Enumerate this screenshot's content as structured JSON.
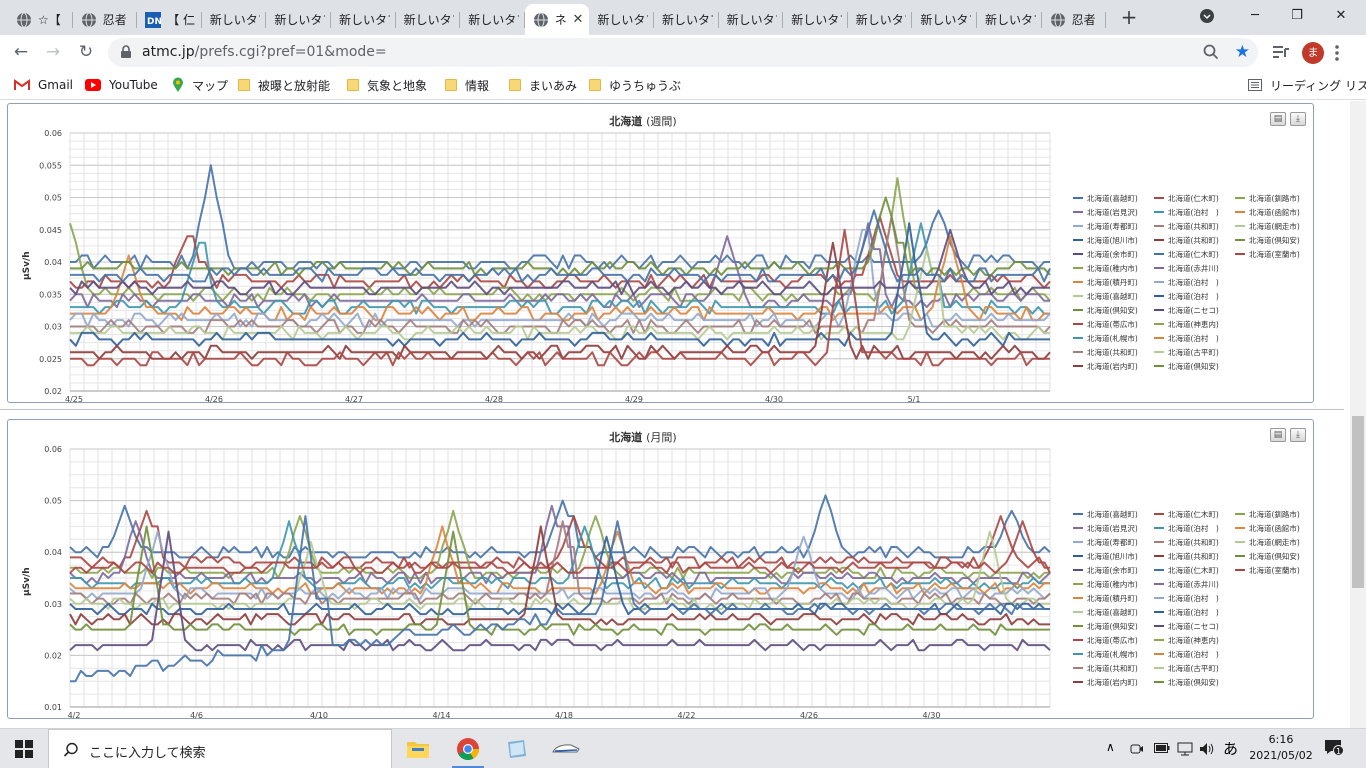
{
  "browser": {
    "tabs": [
      {
        "title": "☆【",
        "icon": "globe-icon",
        "active": false
      },
      {
        "title": "忍者",
        "icon": "globe-icon",
        "active": false
      },
      {
        "title": "【 仁",
        "icon": "dn-logo-icon",
        "active": false
      },
      {
        "title": "新しいタブ",
        "icon": "",
        "active": false
      },
      {
        "title": "新しいタブ",
        "icon": "",
        "active": false
      },
      {
        "title": "新しいタブ",
        "icon": "",
        "active": false
      },
      {
        "title": "新しいタブ",
        "icon": "",
        "active": false
      },
      {
        "title": "新しいタブ",
        "icon": "",
        "active": false
      },
      {
        "title": "ネ",
        "icon": "globe-icon",
        "active": true
      },
      {
        "title": "新しいタブ",
        "icon": "",
        "active": false
      },
      {
        "title": "新しいタブ",
        "icon": "",
        "active": false
      },
      {
        "title": "新しいタブ",
        "icon": "",
        "active": false
      },
      {
        "title": "新しいタブ",
        "icon": "",
        "active": false
      },
      {
        "title": "新しいタブ",
        "icon": "",
        "active": false
      },
      {
        "title": "新しいタブ",
        "icon": "",
        "active": false
      },
      {
        "title": "新しいタブ",
        "icon": "",
        "active": false
      },
      {
        "title": "忍者",
        "icon": "globe-icon",
        "active": false
      }
    ],
    "url_host": "atmc.jp",
    "url_path": "/prefs.cgi?pref=01&mode=",
    "profile_initial": "ま",
    "bookmarks": [
      {
        "label": "Gmail",
        "icon": "gmail-icon"
      },
      {
        "label": "YouTube",
        "icon": "youtube-icon"
      },
      {
        "label": "マップ",
        "icon": "maps-pin-icon"
      },
      {
        "label": "被曝と放射能",
        "icon": "folder-icon"
      },
      {
        "label": "気象と地象",
        "icon": "folder-icon"
      },
      {
        "label": "情報",
        "icon": "folder-icon"
      },
      {
        "label": "まいあみ",
        "icon": "folder-icon"
      },
      {
        "label": "ゆうちゅうぶ",
        "icon": "folder-icon"
      }
    ],
    "reading_list": "リーディング リスト"
  },
  "colors": {
    "accent": "#1a73e8",
    "series_palette": [
      "#4572a7",
      "#aa4643",
      "#89a54e",
      "#80699b",
      "#3d96ae",
      "#db843d",
      "#92a8cd",
      "#a47d7c",
      "#b5ca92",
      "#2f5f98",
      "#8e3b3b",
      "#6f8f3a",
      "#5e4b7e"
    ]
  },
  "chart_data": [
    {
      "type": "line",
      "title": "北海道",
      "period": "(週間)",
      "ylabel": "μSv/h",
      "ylim": [
        0.02,
        0.06
      ],
      "yticks": [
        "0.02",
        "0.025",
        "0.03",
        "0.035",
        "0.04",
        "0.045",
        "0.05",
        "0.055",
        "0.06"
      ],
      "x_ticks": [
        "4/25",
        "4/26",
        "4/27",
        "4/28",
        "4/29",
        "4/30",
        "5/1"
      ],
      "x_points": 168,
      "legend_columns": [
        [
          "北海道(喜越町)",
          "北海道(岩見沢)",
          "北海道(寿都町)",
          "北海道(旭川市)",
          "北海道(余市町)",
          "北海道(稚内市)",
          "北海道(積丹町)",
          "北海道(喜越町)",
          "北海道(倶知安)",
          "北海道(帯広市)",
          "北海道(札幌市)",
          "北海道(共和町)",
          "北海道(岩内町)"
        ],
        [
          "北海道(仁木町)",
          "北海道(泊村　)",
          "北海道(共和町)",
          "北海道(共和町)",
          "北海道(仁木町)",
          "北海道(赤井川)",
          "北海道(泊村　)",
          "北海道(泊村　)",
          "北海道(ニセコ)",
          "北海道(神恵内)",
          "北海道(泊村　)",
          "北海道(古平町)",
          "北海道(倶知安)"
        ],
        [
          "北海道(釧路市)",
          "北海道(函館市)",
          "北海道(網走市)",
          "北海道(倶知安)",
          "北海道(室蘭市)"
        ]
      ],
      "series": [
        {
          "base": 0.04,
          "spikes": [
            [
              24,
              0.055
            ],
            [
              148,
              0.048
            ]
          ]
        },
        {
          "base": 0.037,
          "spikes": [
            [
              20,
              0.044
            ],
            [
              138,
              0.047
            ]
          ]
        },
        {
          "base": 0.035,
          "spikes": [
            [
              0,
              0.046
            ],
            [
              141,
              0.053
            ]
          ]
        },
        {
          "base": 0.034,
          "spikes": [
            [
              112,
              0.044
            ],
            [
              136,
              0.046
            ]
          ]
        },
        {
          "base": 0.033,
          "spikes": [
            [
              22,
              0.043
            ],
            [
              145,
              0.046
            ]
          ]
        },
        {
          "base": 0.032,
          "spikes": [
            [
              10,
              0.041
            ],
            [
              150,
              0.044
            ]
          ]
        },
        {
          "base": 0.031,
          "spikes": [
            [
              135,
              0.045
            ]
          ]
        },
        {
          "base": 0.03,
          "spikes": [
            [
              140,
              0.047
            ]
          ]
        },
        {
          "base": 0.029,
          "spikes": [
            [
              146,
              0.042
            ]
          ]
        },
        {
          "base": 0.028,
          "spikes": [
            [
              143,
              0.046
            ]
          ]
        },
        {
          "base": 0.026,
          "spikes": [
            [
              130,
              0.043
            ]
          ]
        },
        {
          "base": 0.039,
          "spikes": [
            [
              139,
              0.05
            ]
          ]
        },
        {
          "base": 0.036,
          "spikes": [
            [
              150,
              0.045
            ]
          ]
        },
        {
          "base": 0.038,
          "spikes": [
            [
              137,
              0.048
            ]
          ]
        },
        {
          "base": 0.025,
          "spikes": [
            [
              132,
              0.045
            ]
          ]
        }
      ]
    },
    {
      "type": "line",
      "title": "北海道",
      "period": "(月間)",
      "ylabel": "μSv/h",
      "ylim": [
        0.01,
        0.06
      ],
      "yticks": [
        "0.01",
        "0.02",
        "0.03",
        "0.04",
        "0.05",
        "0.06"
      ],
      "x_ticks": [
        "4/2",
        "4/6",
        "4/10",
        "4/14",
        "4/18",
        "4/22",
        "4/26",
        "4/30"
      ],
      "x_points": 180,
      "legend_columns": [
        [
          "北海道(喜越町)",
          "北海道(岩見沢)",
          "北海道(寿都町)",
          "北海道(旭川市)",
          "北海道(余市町)",
          "北海道(稚内市)",
          "北海道(積丹町)",
          "北海道(喜越町)",
          "北海道(倶知安)",
          "北海道(帯広市)",
          "北海道(札幌市)",
          "北海道(共和町)",
          "北海道(岩内町)"
        ],
        [
          "北海道(仁木町)",
          "北海道(泊村　)",
          "北海道(共和町)",
          "北海道(共和町)",
          "北海道(仁木町)",
          "北海道(赤井川)",
          "北海道(泊村　)",
          "北海道(泊村　)",
          "北海道(ニセコ)",
          "北海道(神恵内)",
          "北海道(泊村　)",
          "北海道(古平町)",
          "北海道(倶知安)"
        ],
        [
          "北海道(釧路市)",
          "北海道(函館市)",
          "北海道(網走市)",
          "北海道(倶知安)",
          "北海道(室蘭市)"
        ]
      ],
      "series": [
        {
          "base": 0.04,
          "spikes": [
            [
              10,
              0.049
            ],
            [
              90,
              0.05
            ],
            [
              138,
              0.051
            ],
            [
              172,
              0.048
            ]
          ]
        },
        {
          "base": 0.038,
          "spikes": [
            [
              14,
              0.048
            ],
            [
              92,
              0.047
            ],
            [
              170,
              0.047
            ]
          ]
        },
        {
          "base": 0.036,
          "spikes": [
            [
              42,
              0.047
            ],
            [
              70,
              0.048
            ],
            [
              96,
              0.047
            ]
          ]
        },
        {
          "base": 0.035,
          "spikes": [
            [
              12,
              0.046
            ],
            [
              88,
              0.049
            ]
          ]
        },
        {
          "base": 0.034,
          "spikes": [
            [
              40,
              0.046
            ],
            [
              94,
              0.045
            ]
          ]
        },
        {
          "base": 0.033,
          "spikes": [
            [
              68,
              0.045
            ],
            [
              100,
              0.044
            ]
          ]
        },
        {
          "base": 0.032,
          "spikes": [
            [
              16,
              0.044
            ],
            [
              134,
              0.043
            ]
          ]
        },
        {
          "base": 0.031,
          "spikes": [
            [
              90,
              0.046
            ]
          ]
        },
        {
          "base": 0.03,
          "spikes": [
            [
              44,
              0.042
            ],
            [
              168,
              0.044
            ]
          ]
        },
        {
          "base": 0.029,
          "spikes": [
            [
              98,
              0.043
            ]
          ]
        },
        {
          "base": 0.027,
          "spikes": [
            [
              86,
              0.045
            ]
          ]
        },
        {
          "base": 0.025,
          "spikes": [
            [
              14,
              0.045
            ],
            [
              70,
              0.044
            ]
          ]
        },
        {
          "base": 0.022,
          "spikes": [
            [
              18,
              0.044
            ]
          ]
        },
        {
          "base": 0.016,
          "ramp_to": 0.029,
          "ramp_end": 100,
          "spikes": [
            [
              43,
              0.047
            ],
            [
              100,
              0.046
            ]
          ]
        },
        {
          "base": 0.037,
          "spikes": [
            [
              174,
              0.046
            ]
          ]
        }
      ]
    }
  ],
  "taskbar": {
    "search_placeholder": "ここに入力して検索",
    "ime": "あ",
    "time": "6:16",
    "date": "2021/05/02",
    "notification_count": "1"
  }
}
